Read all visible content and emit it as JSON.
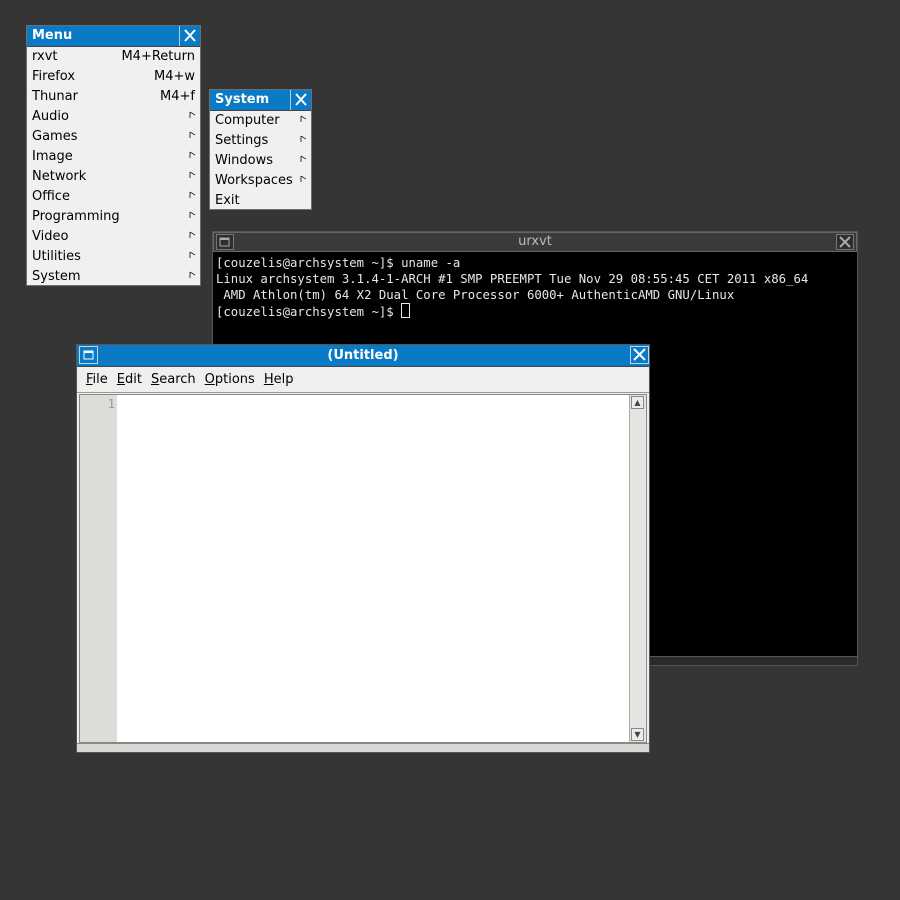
{
  "main_menu": {
    "title": "Menu",
    "items": [
      {
        "label": "rxvt",
        "shortcut": "M4+Return",
        "submenu": false
      },
      {
        "label": "Firefox",
        "shortcut": "M4+w",
        "submenu": false
      },
      {
        "label": "Thunar",
        "shortcut": "M4+f",
        "submenu": false
      },
      {
        "label": "Audio",
        "shortcut": "",
        "submenu": true
      },
      {
        "label": "Games",
        "shortcut": "",
        "submenu": true
      },
      {
        "label": "Image",
        "shortcut": "",
        "submenu": true
      },
      {
        "label": "Network",
        "shortcut": "",
        "submenu": true
      },
      {
        "label": "Office",
        "shortcut": "",
        "submenu": true
      },
      {
        "label": "Programming",
        "shortcut": "",
        "submenu": true
      },
      {
        "label": "Video",
        "shortcut": "",
        "submenu": true
      },
      {
        "label": "Utilities",
        "shortcut": "",
        "submenu": true
      },
      {
        "label": "System",
        "shortcut": "",
        "submenu": true
      }
    ]
  },
  "system_menu": {
    "title": "System",
    "items": [
      {
        "label": "Computer",
        "submenu": true
      },
      {
        "label": "Settings",
        "submenu": true
      },
      {
        "label": "Windows",
        "submenu": true
      },
      {
        "label": "Workspaces",
        "submenu": true
      },
      {
        "label": "Exit",
        "submenu": false
      }
    ]
  },
  "terminal": {
    "title": "urxvt",
    "lines": [
      "[couzelis@archsystem ~]$ uname -a",
      "Linux archsystem 3.1.4-1-ARCH #1 SMP PREEMPT Tue Nov 29 08:55:45 CET 2011 x86_64",
      " AMD Athlon(tm) 64 X2 Dual Core Processor 6000+ AuthenticAMD GNU/Linux"
    ],
    "prompt": "[couzelis@archsystem ~]$ "
  },
  "editor": {
    "title": "(Untitled)",
    "menus": [
      {
        "accel": "F",
        "rest": "ile"
      },
      {
        "accel": "E",
        "rest": "dit"
      },
      {
        "accel": "S",
        "rest": "earch"
      },
      {
        "accel": "O",
        "rest": "ptions"
      },
      {
        "accel": "H",
        "rest": "elp"
      }
    ],
    "line_number": "1"
  },
  "icons": {
    "close": "close-icon",
    "iconify": "iconify-icon",
    "submenu": "submenu-arrow-icon"
  },
  "colors": {
    "desktop": "#353535",
    "title_active": "#0a7ac6",
    "terminal_bg": "#000000"
  }
}
